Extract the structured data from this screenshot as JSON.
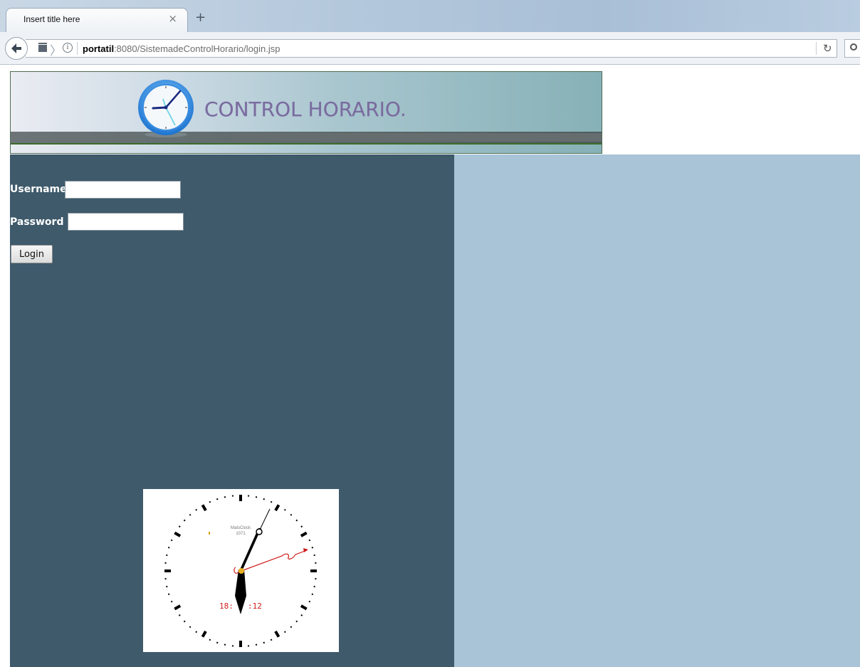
{
  "browser": {
    "tab_title": "Insert title here",
    "tab_close": "×",
    "new_tab": "+",
    "url_host": "portatil",
    "url_rest": ":8080/SistemadeControlHorario/login.jsp",
    "back_glyph": "🡐",
    "reload_glyph": "↻",
    "info_glyph": "i"
  },
  "banner": {
    "title": "CONTROL HORARIO."
  },
  "login_form": {
    "username_label": "Username:",
    "username_value": "",
    "password_label": "Password :",
    "password_value": "",
    "login_button": "Login"
  },
  "clock_widget": {
    "brand": "MatsClock",
    "model": "1071",
    "digital_time_left": "18:",
    "digital_time_right": ":12"
  },
  "colors": {
    "left_panel": "#3e5a6b",
    "right_panel": "#a8c4d6",
    "banner_title": "#7a6b9e",
    "digital_time": "#d21a1a"
  }
}
